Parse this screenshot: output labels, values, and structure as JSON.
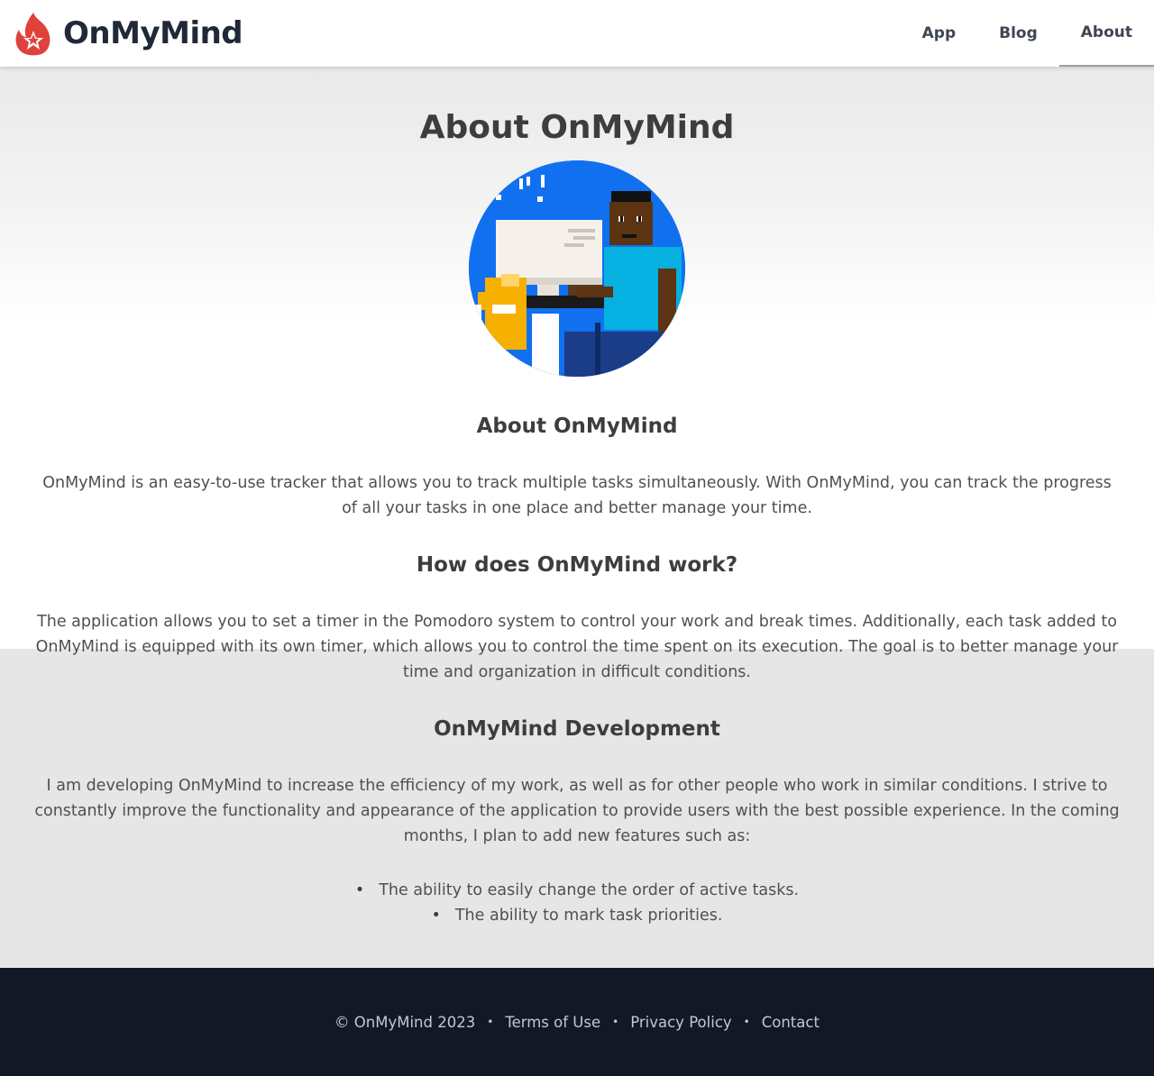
{
  "brand": {
    "name": "OnMyMind",
    "logo_icon": "flame-star-icon",
    "accent": "#e0413a"
  },
  "nav": {
    "items": [
      {
        "label": "App"
      },
      {
        "label": "Blog"
      },
      {
        "label": "About",
        "active": true
      }
    ]
  },
  "main": {
    "title": "About OnMyMind",
    "hero_image": "pixel-art-developer-at-computer",
    "sections": [
      {
        "heading": "About OnMyMind",
        "text": "OnMyMind is an easy-to-use tracker that allows you to track multiple tasks simultaneously. With OnMyMind, you can track the progress of all your tasks in one place and better manage your time."
      },
      {
        "heading": "How does OnMyMind work?",
        "text": "The application allows you to set a timer in the Pomodoro system to control your work and break times. Additionally, each task added to OnMyMind is equipped with its own timer, which allows you to control the time spent on its execution. The goal is to better manage your time and organization in difficult conditions."
      },
      {
        "heading": "OnMyMind Development",
        "text": "I am developing OnMyMind to increase the efficiency of my work, as well as for other people who work in similar conditions. I strive to constantly improve the functionality and appearance of the application to provide users with the best possible experience. In the coming months, I plan to add new features such as:"
      }
    ],
    "features": [
      "The ability to easily change the order of active tasks.",
      "The ability to mark task priorities."
    ]
  },
  "footer": {
    "copyright": "© OnMyMind 2023",
    "separator": "•",
    "links": [
      "Terms of Use",
      "Privacy Policy",
      "Contact"
    ],
    "background": "#121826"
  }
}
